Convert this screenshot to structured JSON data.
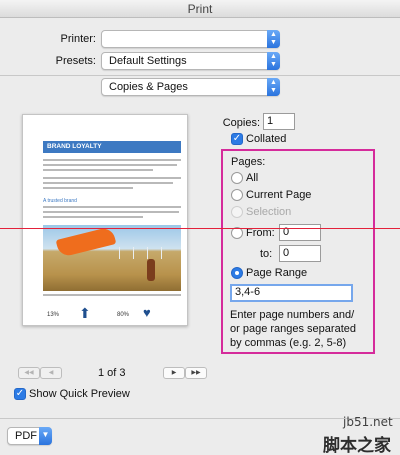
{
  "window": {
    "title": "Print"
  },
  "printer": {
    "label": "Printer:",
    "value": ""
  },
  "presets": {
    "label": "Presets:",
    "value": "Default Settings"
  },
  "section": {
    "value": "Copies & Pages"
  },
  "copies": {
    "label": "Copies:",
    "value": "1",
    "collated_label": "Collated",
    "collated": true
  },
  "pages": {
    "label": "Pages:",
    "options": {
      "all": "All",
      "current": "Current Page",
      "selection": "Selection",
      "from": "From:",
      "to": "to:",
      "range": "Page Range"
    },
    "from_value": "0",
    "to_value": "0",
    "range_value": "3,4-6",
    "help": [
      "Enter page numbers and/",
      "or page ranges separated",
      "by commas (e.g. 2, 5-8)"
    ]
  },
  "preview_doc": {
    "heading": "BRAND LOYALTY",
    "subheading": "A trusted brand",
    "stats": [
      "13%",
      "80%"
    ]
  },
  "page_nav": {
    "indicator": "1 of 3",
    "first": "◀◀",
    "prev": "◀",
    "next": "▶",
    "last": "▶▶"
  },
  "quick_preview": {
    "label": "Show Quick Preview",
    "checked": true
  },
  "pdf": {
    "label": "PDF"
  },
  "watermark": {
    "site": "jb51.net",
    "name": "脚本之家"
  },
  "colors": {
    "accent": "#2c7be5",
    "highlight_box": "#d52b9b",
    "guide_line": "#e3213a"
  }
}
